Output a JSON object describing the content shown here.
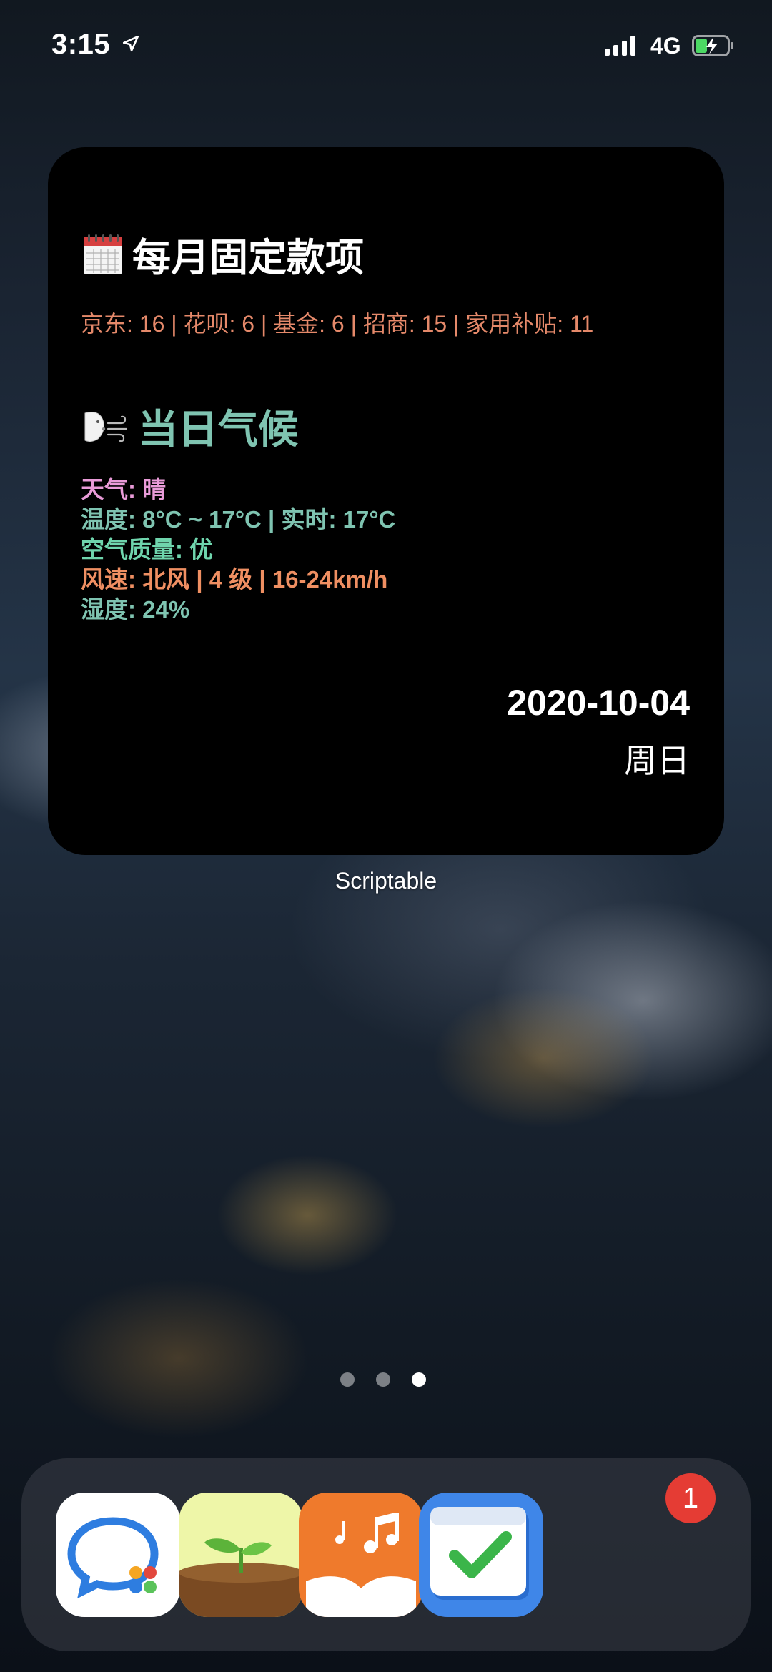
{
  "status_bar": {
    "time": "3:15",
    "network": "4G"
  },
  "widget": {
    "section1_title": "每月固定款项",
    "payments_line": "京东: 16 |  花呗: 6 |  基金: 6 |  招商: 15 |  家用补贴: 11",
    "section2_title": "当日气候",
    "weather": {
      "condition": "天气: 晴",
      "temperature": "温度: 8°C ~ 17°C | 实时: 17°C",
      "air_quality": "空气质量: 优",
      "wind": "风速: 北风 | 4 级 | 16-24km/h",
      "humidity": "湿度: 24%"
    },
    "date": "2020-10-04",
    "weekday": "周日",
    "label": "Scriptable"
  },
  "page_dots": {
    "count": 3,
    "active_index": 2
  },
  "dock": {
    "apps": [
      {
        "name": "WeCom",
        "icon": "chat-bubbles-icon"
      },
      {
        "name": "Forest",
        "icon": "sprout-icon"
      },
      {
        "name": "Books Audio",
        "icon": "music-book-icon"
      },
      {
        "name": "Things",
        "icon": "calendar-check-icon"
      }
    ],
    "badge": "1"
  },
  "colors": {
    "payments": "#e5896a",
    "teal": "#7fc4b1",
    "pink": "#e99bd8",
    "green": "#6fd5ad",
    "orange": "#ef8f62",
    "badge": "#e53c34"
  }
}
